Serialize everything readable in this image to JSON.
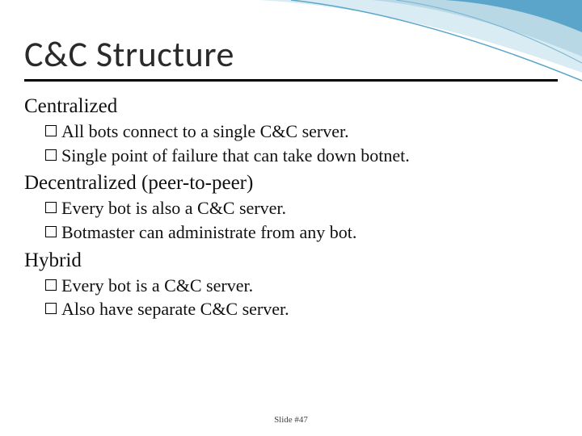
{
  "title": "C&C Structure",
  "sections": [
    {
      "heading": "Centralized",
      "bullets": [
        "All bots connect to a single C&C server.",
        "Single point of failure that can take down botnet."
      ]
    },
    {
      "heading": "Decentralized (peer-to-peer)",
      "bullets": [
        "Every bot is also a C&C server.",
        "Botmaster  can administrate from any bot."
      ]
    },
    {
      "heading": "Hybrid",
      "bullets": [
        "Every bot is a C&C server.",
        "Also have separate C&C server."
      ]
    }
  ],
  "footer": "Slide #47",
  "deco_colors": {
    "arc1": "#5aa5c9",
    "arc2": "#b9d8e6",
    "arc3": "#d9ecf3"
  }
}
